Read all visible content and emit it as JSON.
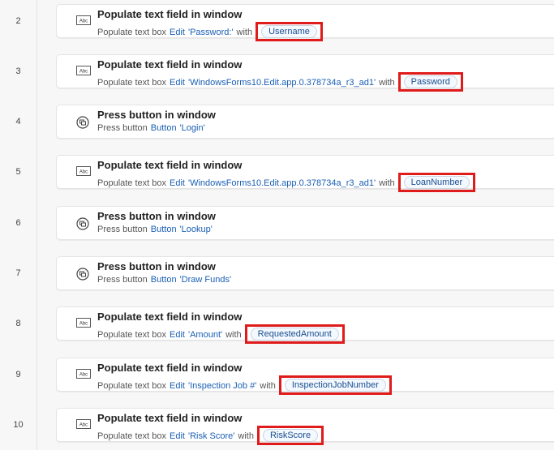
{
  "steps": [
    {
      "number": "2",
      "icon": "text-field-icon",
      "title": "Populate text field in window",
      "prefix": "Populate text box",
      "control_type": "Edit",
      "control_name": "'Password:'",
      "connector": "with",
      "variable": "Username"
    },
    {
      "number": "3",
      "icon": "text-field-icon",
      "title": "Populate text field in window",
      "prefix": "Populate text box",
      "control_type": "Edit",
      "control_name": "'WindowsForms10.Edit.app.0.378734a_r3_ad1'",
      "connector": "with",
      "variable": "Password"
    },
    {
      "number": "4",
      "icon": "press-button-icon",
      "title": "Press button in window",
      "prefix": "Press button",
      "control_type": "Button",
      "control_name": "'Login'",
      "connector": "",
      "variable": ""
    },
    {
      "number": "5",
      "icon": "text-field-icon",
      "title": "Populate text field in window",
      "prefix": "Populate text box",
      "control_type": "Edit",
      "control_name": "'WindowsForms10.Edit.app.0.378734a_r3_ad1'",
      "connector": "with",
      "variable": "LoanNumber"
    },
    {
      "number": "6",
      "icon": "press-button-icon",
      "title": "Press button in window",
      "prefix": "Press button",
      "control_type": "Button",
      "control_name": "'Lookup'",
      "connector": "",
      "variable": ""
    },
    {
      "number": "7",
      "icon": "press-button-icon",
      "title": "Press button in window",
      "prefix": "Press button",
      "control_type": "Button",
      "control_name": "'Draw Funds'",
      "connector": "",
      "variable": ""
    },
    {
      "number": "8",
      "icon": "text-field-icon",
      "title": "Populate text field in window",
      "prefix": "Populate text box",
      "control_type": "Edit",
      "control_name": "'Amount'",
      "connector": "with",
      "variable": "RequestedAmount"
    },
    {
      "number": "9",
      "icon": "text-field-icon",
      "title": "Populate text field in window",
      "prefix": "Populate text box",
      "control_type": "Edit",
      "control_name": "'Inspection Job #'",
      "connector": "with",
      "variable": "InspectionJobNumber"
    },
    {
      "number": "10",
      "icon": "text-field-icon",
      "title": "Populate text field in window",
      "prefix": "Populate text box",
      "control_type": "Edit",
      "control_name": "'Risk Score'",
      "connector": "with",
      "variable": "RiskScore"
    }
  ],
  "colors": {
    "highlight_box": "#e01b1b",
    "link": "#1a5fb4"
  }
}
